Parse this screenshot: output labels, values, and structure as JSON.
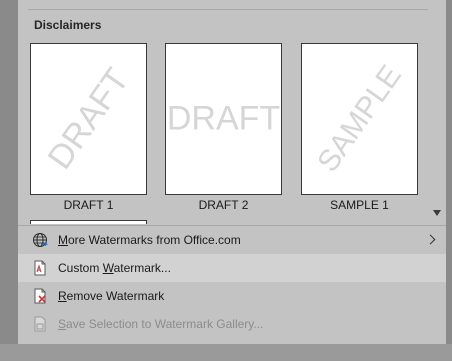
{
  "section": {
    "title": "Disclaimers"
  },
  "watermarks": [
    {
      "label": "DRAFT 1",
      "text": "DRAFT",
      "style": "diagonal"
    },
    {
      "label": "DRAFT 2",
      "text": "DRAFT",
      "style": "horizontal"
    },
    {
      "label": "SAMPLE 1",
      "text": "SAMPLE",
      "style": "diagonal"
    }
  ],
  "menu": {
    "more_watermarks": {
      "pre": "",
      "key": "M",
      "post": "ore Watermarks from Office.com",
      "icon": "globe-icon",
      "has_submenu": true
    },
    "custom_watermark": {
      "pre": "Custom ",
      "key": "W",
      "post": "atermark...",
      "icon": "custom-watermark-icon"
    },
    "remove_watermark": {
      "pre": "",
      "key": "R",
      "post": "emove Watermark",
      "icon": "remove-watermark-icon"
    },
    "save_selection": {
      "pre": "",
      "key": "S",
      "post": "ave Selection to Watermark Gallery...",
      "icon": "save-watermark-icon",
      "disabled": true
    }
  },
  "colors": {
    "panel": "#c3c3c3",
    "hover": "#d2d2d2",
    "disabled_text": "#8c8c8c",
    "watermark": "#d6d6d6"
  }
}
